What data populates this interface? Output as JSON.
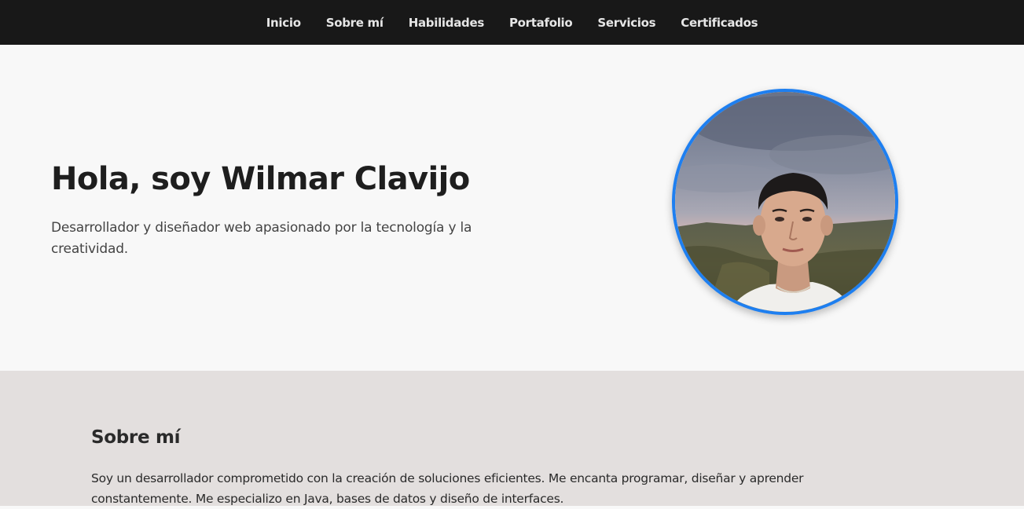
{
  "nav": {
    "items": [
      {
        "label": "Inicio"
      },
      {
        "label": "Sobre mí"
      },
      {
        "label": "Habilidades"
      },
      {
        "label": "Portafolio"
      },
      {
        "label": "Servicios"
      },
      {
        "label": "Certificados"
      }
    ]
  },
  "hero": {
    "title": "Hola, soy Wilmar Clavijo",
    "subtitle": "Desarrollador y diseñador web apasionado por la tecnología y la creatividad."
  },
  "about": {
    "title": "Sobre mí",
    "text": "Soy un desarrollador comprometido con la creación de soluciones eficientes. Me encanta programar, diseñar y aprender constantemente. Me especializo en Java, bases de datos y diseño de interfaces."
  },
  "colors": {
    "navbar_bg": "#181818",
    "accent": "#1e7ff0",
    "hero_bg": "#f8f8f8",
    "about_bg": "#e3dfde"
  }
}
